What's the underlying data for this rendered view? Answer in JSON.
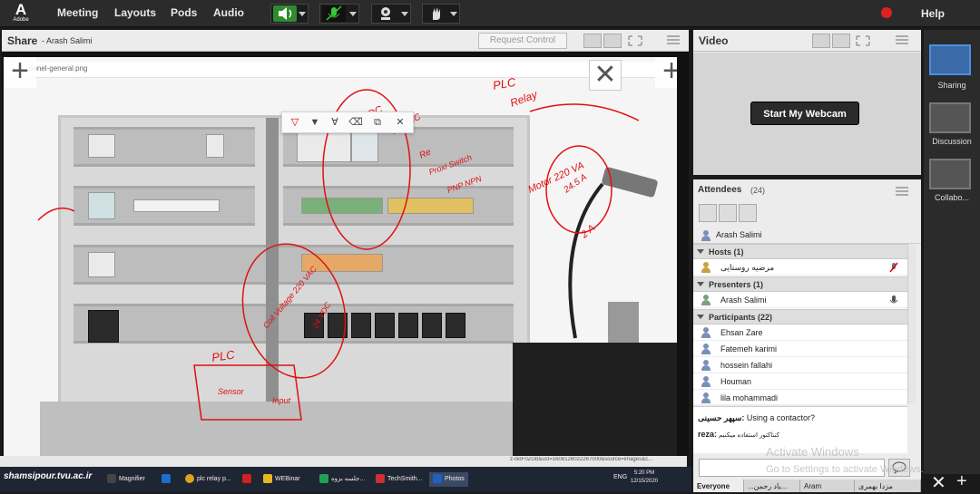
{
  "topbar": {
    "logo_letter": "A",
    "logo_text": "Adobe",
    "menu": [
      "Meeting",
      "Layouts",
      "Pods",
      "Audio"
    ],
    "help_label": "Help",
    "icons": [
      "speaker-icon",
      "mic-muted-icon",
      "webcam-icon",
      "raise-hand-icon"
    ],
    "accent_green": "#2f8a2f"
  },
  "share": {
    "title": "Share",
    "presenter": "- Arash Salimi",
    "request_control_label": "Request Control",
    "file_name": "ponel-general.png"
  },
  "annotation_overlay": {
    "texts": [
      "PLC",
      "Relay",
      "24VDC",
      "24 VDC",
      "Re",
      "Proxi Switch",
      "PNP NPN",
      "Motor 220 VA",
      "24.5 A",
      "2 A",
      "Coil Voltage 220 VAC",
      "24 VDC",
      "PLC",
      "Sensor",
      "Input"
    ]
  },
  "taskbar": {
    "site": "shamsipour.tvu.ac.ir",
    "apps": [
      "Magnifier",
      "",
      "plc relay p...",
      "",
      "WEBinar",
      "جلسه بزوه...",
      "TechSmith...",
      "Photos"
    ],
    "lang": "ENG",
    "time": "5:20 PM",
    "date": "12/15/2020",
    "url_fragment": "z-ckIF0ZGb&ust=1608126022287000&source=images&c..."
  },
  "video": {
    "title": "Video",
    "webcam_button": "Start My Webcam"
  },
  "attendees": {
    "title": "Attendees",
    "count": "(24)",
    "me": "Arash Salimi",
    "hosts_label": "Hosts (1)",
    "hosts": [
      "مرضیه روستایی"
    ],
    "presenters_label": "Presenters (1)",
    "presenters": [
      "Arash Salimi"
    ],
    "participants_label": "Participants (22)",
    "participants": [
      "Ehsan Zare",
      "Fatemeh karimi",
      "hossein fallahi",
      "Houman",
      "lila mohammadi"
    ]
  },
  "chat": {
    "lines": [
      {
        "name": "سپهر حسینی:",
        "text": " Using a contactor?"
      },
      {
        "name": "reza:",
        "text": " کنتاکتور استفاده میکنیم"
      }
    ],
    "tabs": [
      "Everyone",
      "...یاد رحمن...",
      "Aram",
      "مزدا بهمری"
    ],
    "watermark_line1": "Activate Windows",
    "watermark_line2": "Go to Settings to activate Windows."
  },
  "layouts": {
    "items": [
      "Sharing",
      "Discussion",
      "Collabo..."
    ]
  }
}
